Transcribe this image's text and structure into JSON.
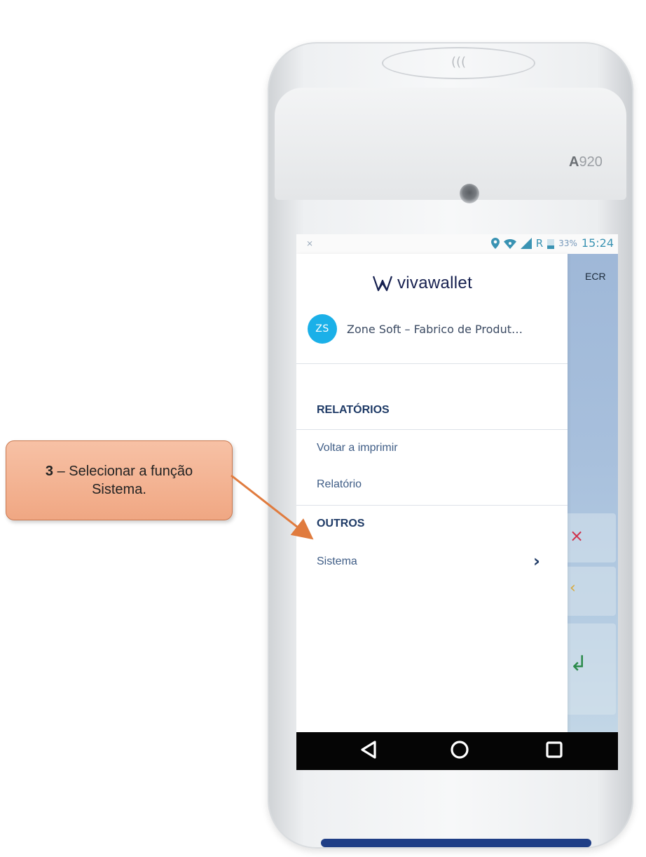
{
  "device": {
    "model_prefix": "A",
    "model_number": "920",
    "nfc_symbol": "((("
  },
  "status_bar": {
    "left_icon": "signal-off-icon",
    "icons": [
      "location-icon",
      "wifi-icon",
      "cell-signal-icon",
      "battery-icon"
    ],
    "network_type": "R",
    "battery_percent": "33%",
    "time": "15:24"
  },
  "background_app": {
    "label": "ECR",
    "keys": [
      {
        "icon": "cancel-icon",
        "glyph": "×"
      },
      {
        "icon": "backspace-icon",
        "glyph": "‹"
      },
      {
        "icon": "enter-icon",
        "glyph": "↲"
      }
    ],
    "colors": {
      "cancel": "#d0304a",
      "backspace": "#d8a93a",
      "enter": "#2a8a4a"
    }
  },
  "drawer": {
    "brand": "vivawallet",
    "brand_color": "#16204f",
    "account": {
      "initials": "ZS",
      "name": "Zone Soft – Fabrico de Produt…",
      "avatar_color": "#1bb0e8"
    },
    "sections": [
      {
        "title": "RELATÓRIOS",
        "items": [
          "Voltar a imprimir",
          "Relatório"
        ]
      },
      {
        "title": "OUTROS",
        "items": [
          "Sistema"
        ]
      }
    ]
  },
  "navigation_bar": {
    "back": "back-icon",
    "home": "home-icon",
    "recents": "recents-icon"
  },
  "callout": {
    "step": "3",
    "text": " – Selecionar a função Sistema.",
    "color": "#f0a783"
  }
}
